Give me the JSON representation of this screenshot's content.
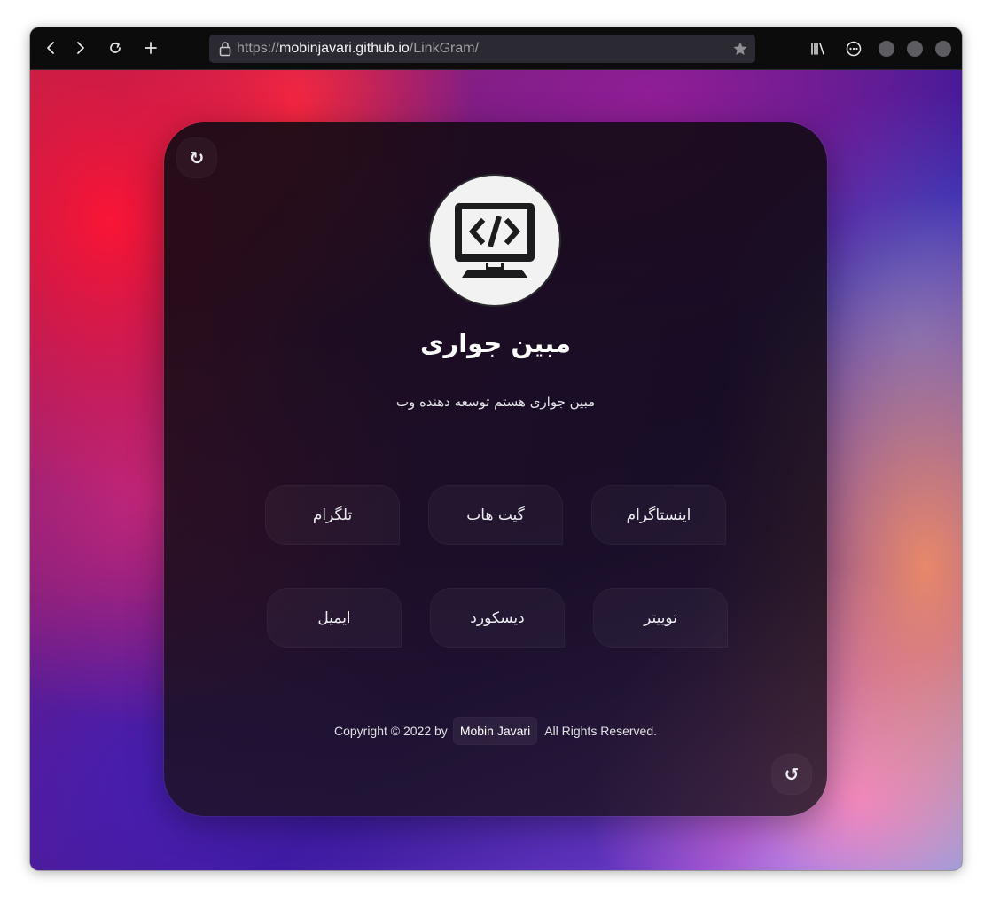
{
  "browser": {
    "url_scheme": "https://",
    "url_host": "mobinjavari.github.io",
    "url_path": "/LinkGram/"
  },
  "profile": {
    "name": "مبین جواری",
    "bio": "مبین جواری هستم توسعه دهنده وب"
  },
  "links": [
    {
      "label": "اینستاگرام"
    },
    {
      "label": "گیت هاب"
    },
    {
      "label": "تلگرام"
    },
    {
      "label": "توییتر"
    },
    {
      "label": "دیسکورد"
    },
    {
      "label": "ایمیل"
    }
  ],
  "corner_buttons": {
    "top_left": "↻",
    "bottom_right": "↺"
  },
  "footer": {
    "prefix": "Copyright © 2022 by",
    "author": "Mobin Javari",
    "suffix": "All Rights Reserved."
  }
}
